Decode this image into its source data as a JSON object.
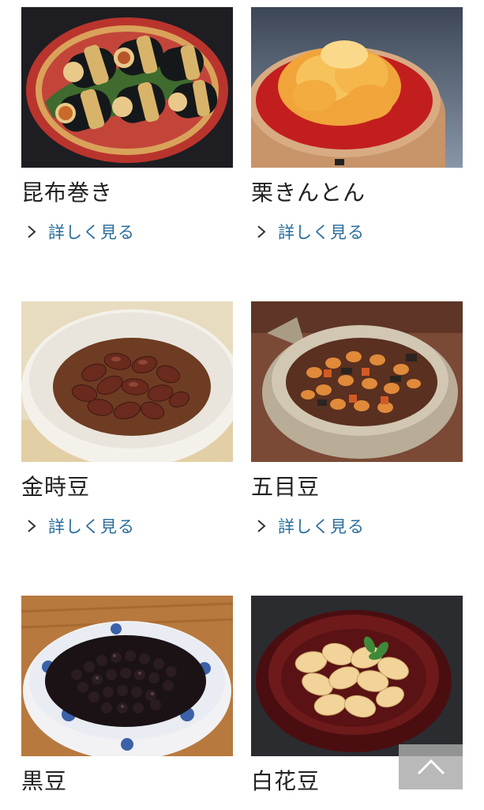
{
  "items": [
    {
      "title": "昆布巻き",
      "more": "詳しく見る"
    },
    {
      "title": "栗きんとん",
      "more": "詳しく見る"
    },
    {
      "title": "金時豆",
      "more": "詳しく見る"
    },
    {
      "title": "五目豆",
      "more": "詳しく見る"
    },
    {
      "title": "黒豆"
    },
    {
      "title": "白花豆"
    }
  ],
  "colors": {
    "link": "#2a6d9c",
    "title": "#222222",
    "scroll_top_bg": "#aaaaaa"
  },
  "icons": {
    "more": "chevron-right-icon",
    "scroll_top": "chevron-up-icon"
  }
}
